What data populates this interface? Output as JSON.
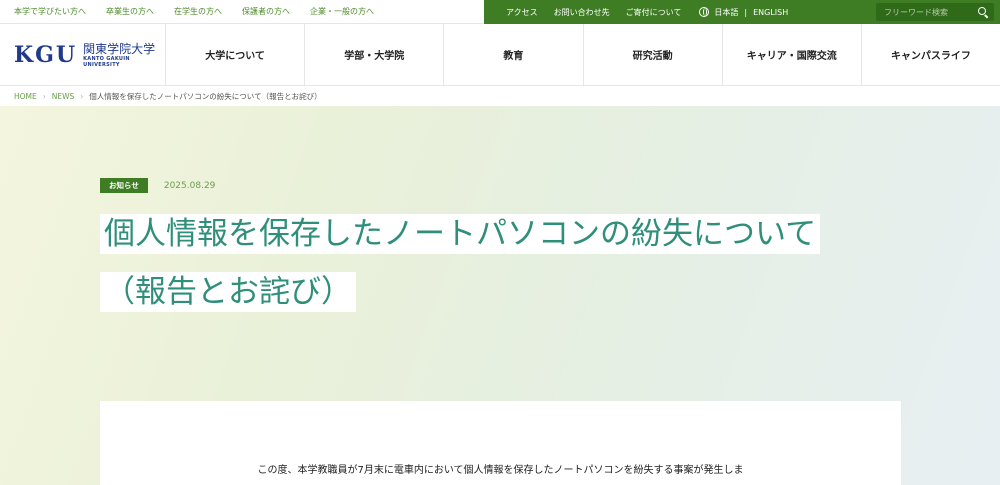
{
  "topbar": {
    "audience_links": [
      "本学で学びたい方へ",
      "卒業生の方へ",
      "在学生の方へ",
      "保護者の方へ",
      "企業・一般の方へ"
    ],
    "access": "アクセス",
    "contact": "お問い合わせ先",
    "donate": "ご寄付について",
    "lang_ja": "日本語",
    "lang_sep": "|",
    "lang_en": "ENGLISH",
    "search_placeholder": "フリーワード検索"
  },
  "logo": {
    "mark": "KGU",
    "name_jp": "関東学院大学",
    "name_en": "KANTO GAKUIN UNIVERSITY"
  },
  "nav": {
    "items": [
      "大学について",
      "学部・大学院",
      "教育",
      "研究活動",
      "キャリア・国際交流",
      "キャンパスライフ"
    ]
  },
  "breadcrumb": {
    "home": "HOME",
    "news": "NEWS",
    "current": "個人情報を保存したノートパソコンの紛失について（報告とお詫び）"
  },
  "article": {
    "tag": "お知らせ",
    "date": "2025.08.29",
    "title_line1": "個人情報を保存したノートパソコンの紛失について",
    "title_line2": "（報告とお詫び）",
    "body_first_line": "この度、本学教職員が7月末に電車内において個人情報を保存したノートパソコンを紛失する事案が発生しま"
  },
  "colors": {
    "brand_green": "#3f7d24",
    "title_teal": "#2f8f7a",
    "logo_navy": "#1f3a8a"
  }
}
